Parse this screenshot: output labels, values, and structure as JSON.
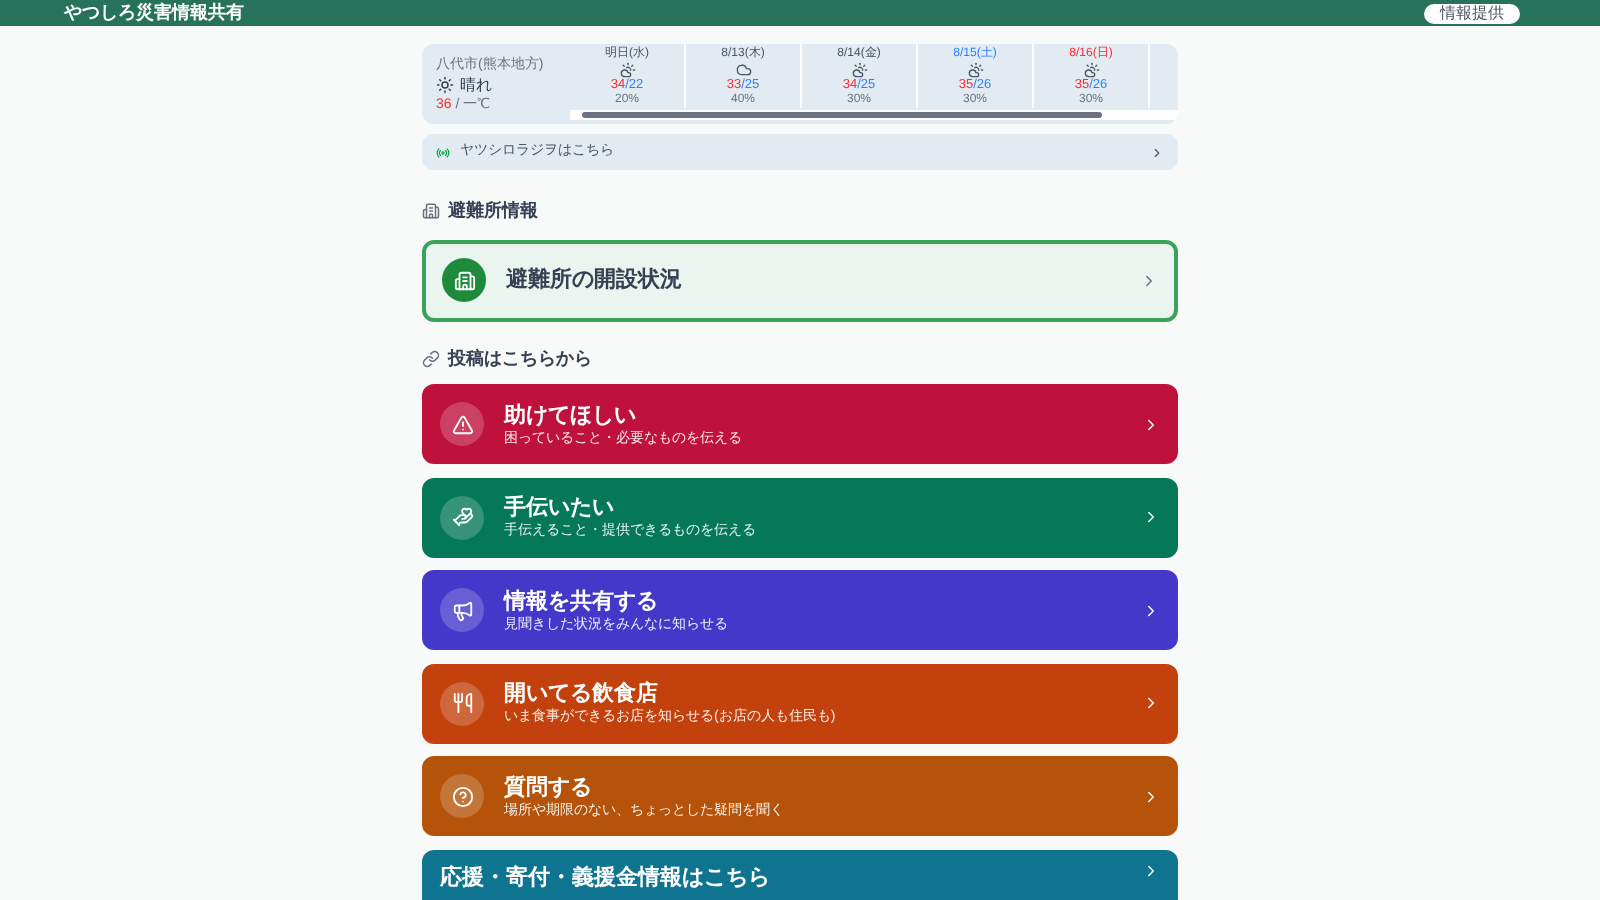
{
  "header": {
    "title": "やつしろ災害情報共有",
    "button": "情報提供"
  },
  "weather": {
    "location": "八代市(熊本地方)",
    "today": "晴れ",
    "high": "36",
    "low": "/ 一℃",
    "days": [
      {
        "date": "明日(水)",
        "kind": "weekday",
        "high": "34",
        "low": "/22",
        "rain": "20%"
      },
      {
        "date": "8/13(木)",
        "kind": "weekday",
        "high": "33",
        "low": "/25",
        "rain": "40%"
      },
      {
        "date": "8/14(金)",
        "kind": "weekday",
        "high": "34",
        "low": "/25",
        "rain": "30%"
      },
      {
        "date": "8/15(土)",
        "kind": "saturday",
        "high": "35",
        "low": "/26",
        "rain": "30%"
      },
      {
        "date": "8/16(日)",
        "kind": "sunday",
        "high": "35",
        "low": "/26",
        "rain": "30%"
      }
    ]
  },
  "radio_link": "ヤツシロラジヲはこちら",
  "shelter_section": {
    "heading": "避難所情報",
    "card": "避難所の開設状況"
  },
  "post_section": {
    "heading": "投稿はこちらから",
    "cards": [
      {
        "kind": "help",
        "title": "助けてほしい",
        "subtitle": "困っていること・必要なものを伝える",
        "color": "#be123c"
      },
      {
        "kind": "volunteer",
        "title": "手伝いたい",
        "subtitle": "手伝えること・提供できるものを伝える",
        "color": "#047857"
      },
      {
        "kind": "share",
        "title": "情報を共有する",
        "subtitle": "見聞きした状況をみんなに知らせる",
        "color": "#4338ca"
      },
      {
        "kind": "restaurant",
        "title": "開いてる飲食店",
        "subtitle": "いま食事ができるお店を知らせる(お店の人も住民も)",
        "color": "#c2410c"
      },
      {
        "kind": "question",
        "title": "質問する",
        "subtitle": "場所や期限のない、ちょっとした疑問を聞く",
        "color": "#b45309"
      }
    ]
  },
  "support_link": {
    "title": "応援・寄付・義援金情報はこちら",
    "color": "#0e7490"
  }
}
